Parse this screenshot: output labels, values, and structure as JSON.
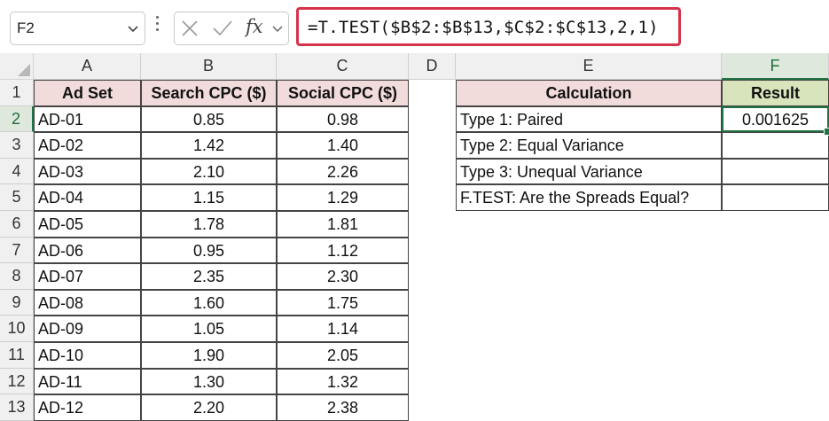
{
  "name_box": {
    "value": "F2"
  },
  "formula_bar": {
    "formula": "=T.TEST($B$2:$B$13,$C$2:$C$13,2,1)",
    "fx_label": "fx"
  },
  "colors": {
    "pink_header": "#f2dcdb",
    "green_header": "#d8e4bc",
    "selection": "#217346",
    "formula_highlight": "#d5334a"
  },
  "columns": [
    "A",
    "B",
    "C",
    "D",
    "E",
    "F"
  ],
  "rows": [
    "1",
    "2",
    "3",
    "4",
    "5",
    "6",
    "7",
    "8",
    "9",
    "10",
    "11",
    "12",
    "13"
  ],
  "table": {
    "headers": [
      "Ad Set",
      "Search CPC ($)",
      "Social CPC ($)"
    ],
    "rows": [
      [
        "AD-01",
        "0.85",
        "0.98"
      ],
      [
        "AD-02",
        "1.42",
        "1.40"
      ],
      [
        "AD-03",
        "2.10",
        "2.26"
      ],
      [
        "AD-04",
        "1.15",
        "1.29"
      ],
      [
        "AD-05",
        "1.78",
        "1.81"
      ],
      [
        "AD-06",
        "0.95",
        "1.12"
      ],
      [
        "AD-07",
        "2.35",
        "2.30"
      ],
      [
        "AD-08",
        "1.60",
        "1.75"
      ],
      [
        "AD-09",
        "1.05",
        "1.14"
      ],
      [
        "AD-10",
        "1.90",
        "2.05"
      ],
      [
        "AD-11",
        "1.30",
        "1.32"
      ],
      [
        "AD-12",
        "2.20",
        "2.38"
      ]
    ]
  },
  "calc": {
    "headers": [
      "Calculation",
      "Result"
    ],
    "rows": [
      [
        "Type 1: Paired",
        "0.001625"
      ],
      [
        "Type 2: Equal Variance",
        ""
      ],
      [
        "Type 3: Unequal Variance",
        ""
      ],
      [
        "F.TEST: Are the Spreads Equal?",
        ""
      ]
    ]
  }
}
